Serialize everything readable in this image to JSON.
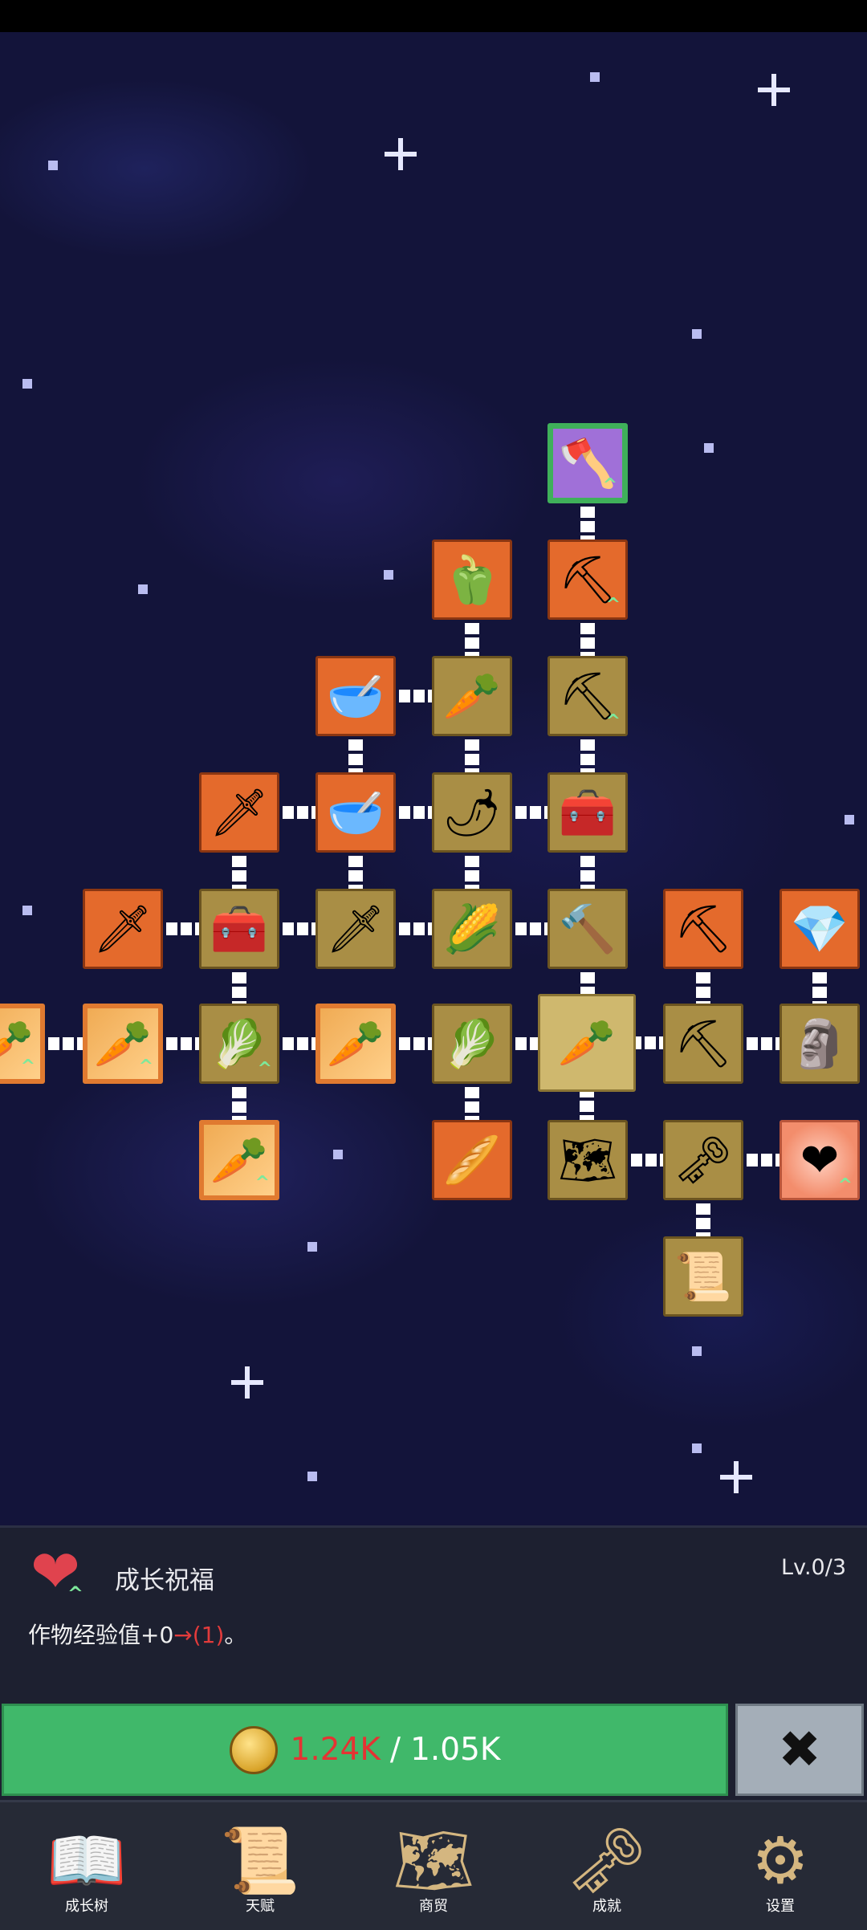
{
  "tree": {
    "nodes": [
      {
        "id": "shovel-top",
        "icon": "🪓",
        "name": "shovel-upgrade-icon",
        "style": "p",
        "up": true
      },
      {
        "id": "pepper",
        "icon": "🫑",
        "name": "pepper-icon",
        "style": "o",
        "up": false
      },
      {
        "id": "shovel-2",
        "icon": "⛏",
        "name": "shovel-icon",
        "style": "o",
        "up": true
      },
      {
        "id": "bowl-1",
        "icon": "🥣",
        "name": "bowl-icon",
        "style": "o",
        "up": false
      },
      {
        "id": "radish",
        "icon": "🥕",
        "name": "radish-icon",
        "style": "g",
        "up": false
      },
      {
        "id": "shovel-3",
        "icon": "⛏",
        "name": "shovel-icon",
        "style": "g",
        "up": true
      },
      {
        "id": "gold-sword",
        "icon": "🗡",
        "name": "gold-sword-icon",
        "style": "o",
        "up": false
      },
      {
        "id": "bowl-2",
        "icon": "🥣",
        "name": "bowl-icon",
        "style": "o",
        "up": false
      },
      {
        "id": "chili",
        "icon": "🌶",
        "name": "chili-icon",
        "style": "g",
        "up": false
      },
      {
        "id": "chest-1",
        "icon": "🧰",
        "name": "chest-icon",
        "style": "g",
        "up": false
      },
      {
        "id": "iron-sword",
        "icon": "🗡",
        "name": "iron-sword-icon",
        "style": "o",
        "up": false
      },
      {
        "id": "chest-2",
        "icon": "🧰",
        "name": "chest-icon",
        "style": "g",
        "up": false
      },
      {
        "id": "sword",
        "icon": "🗡",
        "name": "sword-icon",
        "style": "g",
        "up": false
      },
      {
        "id": "corn",
        "icon": "🌽",
        "name": "corn-icon",
        "style": "g",
        "up": false
      },
      {
        "id": "hoe",
        "icon": "🔨",
        "name": "hoe-icon",
        "style": "g",
        "up": false
      },
      {
        "id": "pickaxe-1",
        "icon": "⛏",
        "name": "pickaxe-icon",
        "style": "o",
        "up": false
      },
      {
        "id": "crystal",
        "icon": "💎",
        "name": "crystal-icon",
        "style": "o",
        "up": false
      },
      {
        "id": "carrot-edge",
        "icon": "🥕",
        "name": "carrot-icon",
        "style": "sp",
        "up": true
      },
      {
        "id": "carrot-1",
        "icon": "🥕",
        "name": "carrot-icon",
        "style": "sp",
        "up": true
      },
      {
        "id": "cabbage-1",
        "icon": "🥬",
        "name": "cabbage-icon",
        "style": "g",
        "up": true
      },
      {
        "id": "carrot-2",
        "icon": "🥕",
        "name": "carrot-icon",
        "style": "sp",
        "up": false
      },
      {
        "id": "cabbage-2",
        "icon": "🥬",
        "name": "cabbage-icon",
        "style": "g",
        "up": false
      },
      {
        "id": "carrot-center",
        "icon": "🥕",
        "name": "carrot-root-icon",
        "style": "sel",
        "up": false
      },
      {
        "id": "pickaxe-2",
        "icon": "⛏",
        "name": "pickaxe-icon",
        "style": "g",
        "up": false
      },
      {
        "id": "statue",
        "icon": "🗿",
        "name": "statue-icon",
        "style": "g",
        "up": false
      },
      {
        "id": "carrot-3",
        "icon": "🥕",
        "name": "carrot-icon",
        "style": "sp",
        "up": true
      },
      {
        "id": "parsnip",
        "icon": "🥖",
        "name": "parsnip-icon",
        "style": "o",
        "up": false
      },
      {
        "id": "map",
        "icon": "🗺",
        "name": "map-icon",
        "style": "g",
        "up": false
      },
      {
        "id": "key",
        "icon": "🗝",
        "name": "key-icon",
        "style": "g",
        "up": false
      },
      {
        "id": "heart",
        "icon": "❤",
        "name": "heart-icon",
        "style": "pink",
        "up": true
      },
      {
        "id": "scroll",
        "icon": "📜",
        "name": "scroll-icon",
        "style": "g",
        "up": false
      }
    ],
    "upgrade_mark": "^"
  },
  "panel": {
    "icon": "heart-icon",
    "title": "成长祝福",
    "level": "Lv.0/3",
    "desc_prefix": "作物经验值+0",
    "desc_arrow": "→(1)",
    "desc_suffix": "。"
  },
  "upgrade": {
    "cost": "1.24K",
    "separator": "/",
    "balance": "1.05K"
  },
  "close_label": "✖",
  "nav": [
    {
      "id": "growth-tree",
      "label": "成长树",
      "icon": "book-icon",
      "glyph": "📖"
    },
    {
      "id": "talent",
      "label": "天赋",
      "icon": "scroll-icon",
      "glyph": "📜"
    },
    {
      "id": "trade",
      "label": "商贸",
      "icon": "map-icon",
      "glyph": "🗺"
    },
    {
      "id": "achievement",
      "label": "成就",
      "icon": "key-icon",
      "glyph": "🗝"
    },
    {
      "id": "settings",
      "label": "设置",
      "icon": "gear-icon",
      "glyph": "⚙"
    }
  ],
  "colors": {
    "orange_node": "#e46a2c",
    "gold_node": "#a98e45",
    "upgrade_green": "#40b86a",
    "cost_red": "#e43333"
  }
}
